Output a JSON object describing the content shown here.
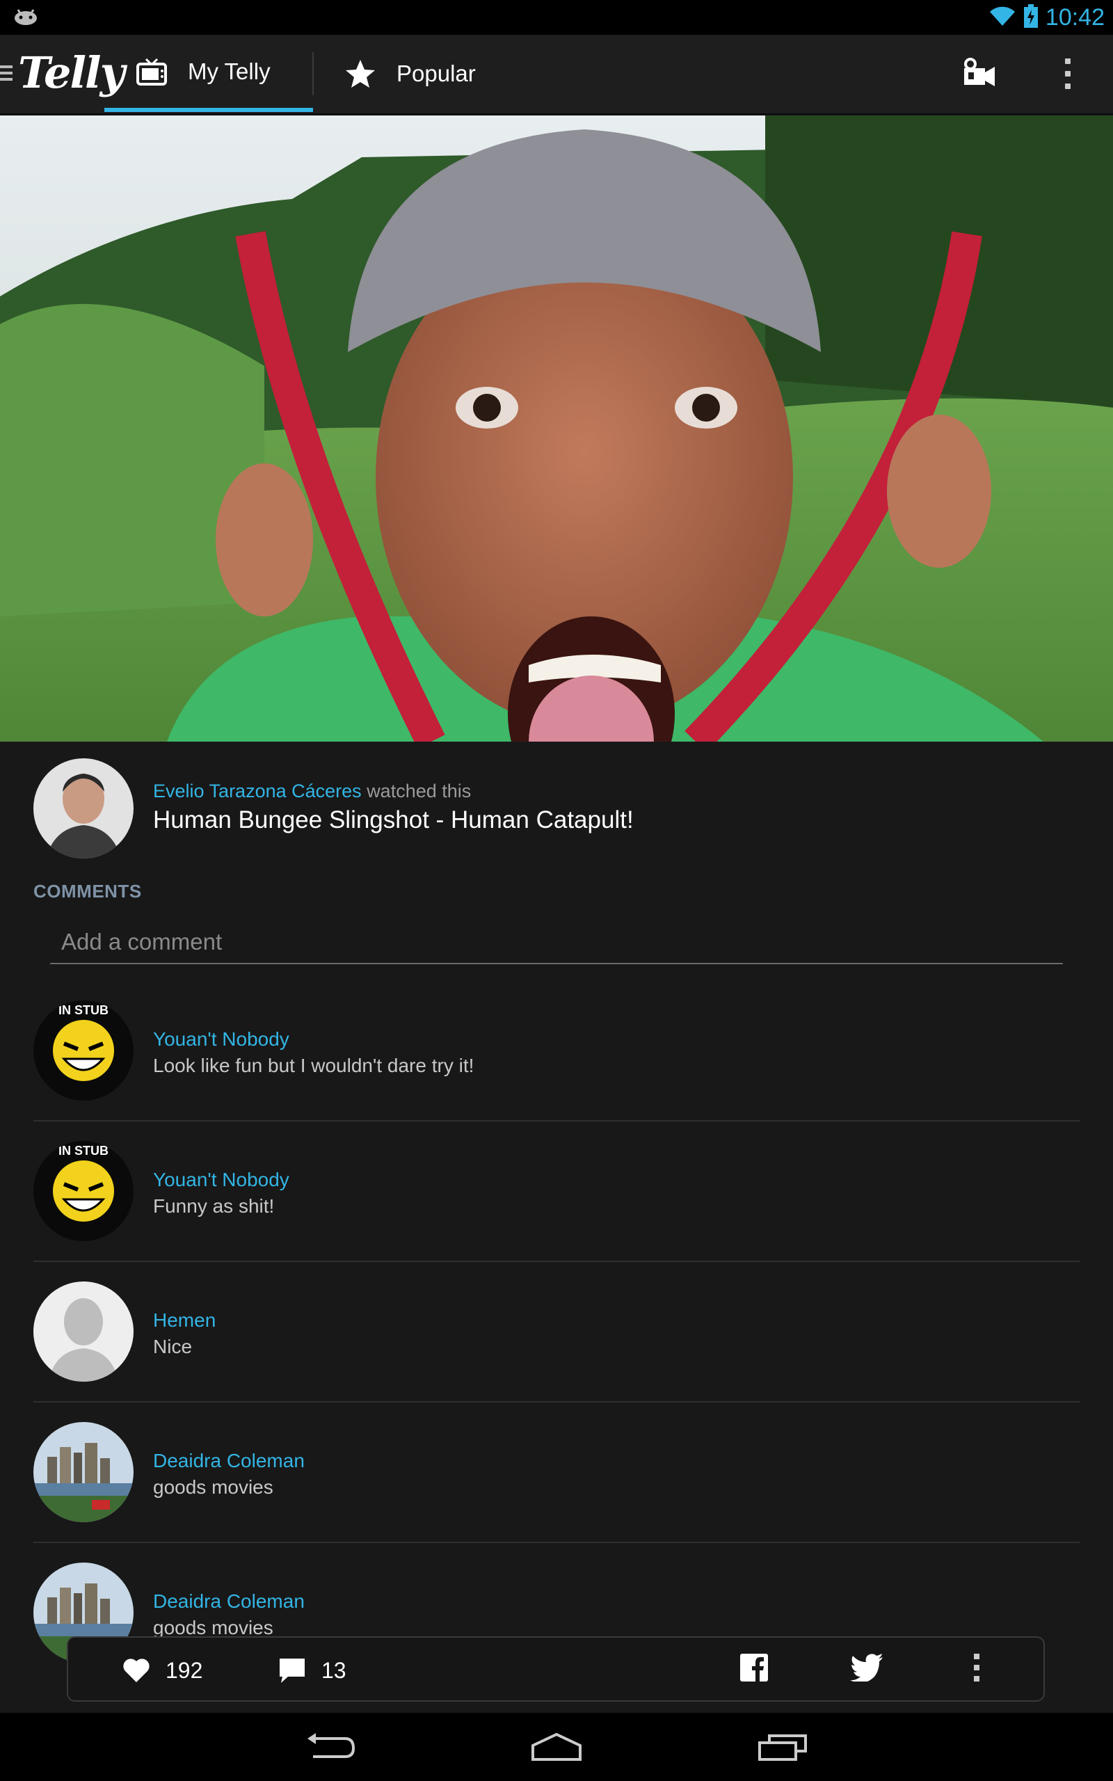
{
  "status_bar": {
    "time": "10:42",
    "left_icon": "android-debug-icon",
    "right_icons": [
      "wifi-icon",
      "battery-charging-icon"
    ]
  },
  "action_bar": {
    "logo": "Telly",
    "tabs": [
      {
        "label": "My Telly",
        "icon": "tv-icon",
        "active": true
      },
      {
        "label": "Popular",
        "icon": "star-icon",
        "active": false
      }
    ],
    "actions": [
      "video-camera-icon",
      "overflow-menu-icon"
    ]
  },
  "post": {
    "user": "Evelio Tarazona Cáceres",
    "action": "watched this",
    "title": "Human Bungee Slingshot - Human Catapult!"
  },
  "comments": {
    "heading": "COMMENTS",
    "input_placeholder": "Add a comment",
    "items": [
      {
        "user": "Youan't  Nobody",
        "text": "Look like fun but I wouldn't dare try it!",
        "avatar": "smiley-avatar"
      },
      {
        "user": "Youan't  Nobody",
        "text": "Funny as shit!",
        "avatar": "smiley-avatar"
      },
      {
        "user": "Hemen",
        "text": "Nice",
        "avatar": "default-person-avatar"
      },
      {
        "user": "Deaidra Coleman",
        "text": "goods movies",
        "avatar": "city-avatar"
      },
      {
        "user": "Deaidra Coleman",
        "text": "goods movies",
        "avatar": "city-avatar"
      }
    ]
  },
  "bottom_bar": {
    "likes": "192",
    "comment_count": "13",
    "share_icons": [
      "facebook-icon",
      "twitter-icon",
      "overflow-menu-icon"
    ]
  },
  "nav_bar": {
    "buttons": [
      "back-icon",
      "home-icon",
      "recent-apps-icon"
    ]
  },
  "colors": {
    "accent": "#33b5e5",
    "background": "#181818",
    "heading": "#7f93a8"
  }
}
